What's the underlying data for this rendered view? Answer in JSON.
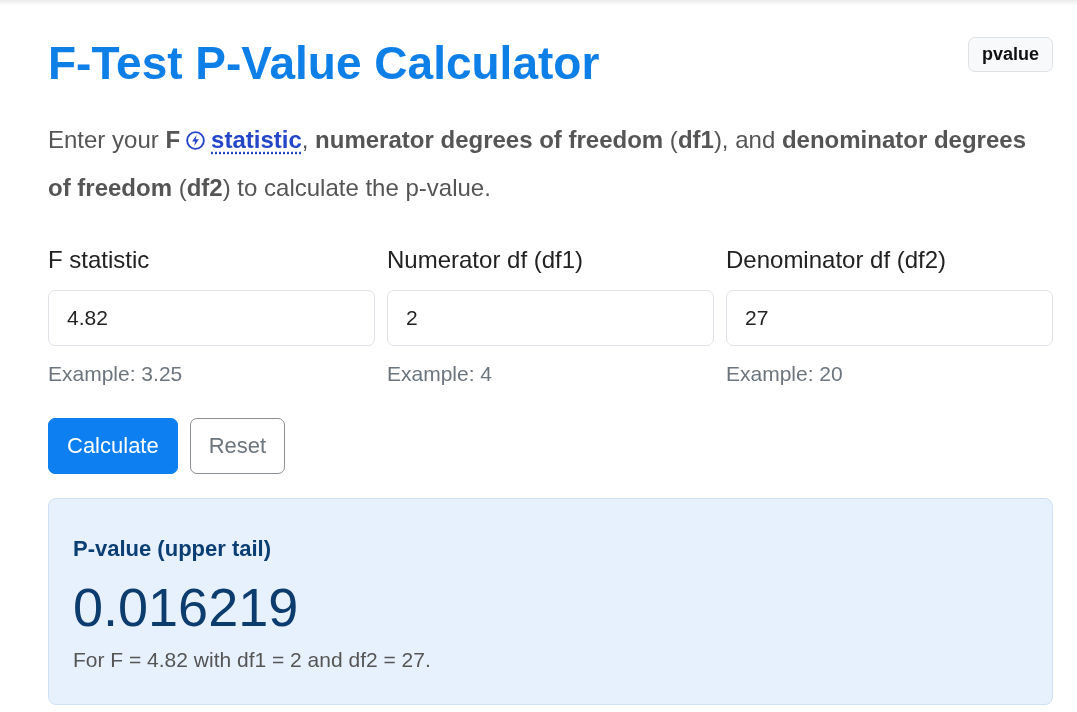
{
  "title": "F-Test P-Value Calculator",
  "badge": "pvalue",
  "intro": {
    "before": "Enter your **F**",
    "link": "statistic",
    "after": ", **numerator degrees of freedom** (**df1**), and **denominator degrees of freedom** (**df2**) to calculate the p-value."
  },
  "fields": [
    {
      "label": "F statistic",
      "value": "4.82",
      "help": "Example: 3.25"
    },
    {
      "label": "Numerator df (df1)",
      "value": "2",
      "help": "Example: 4"
    },
    {
      "label": "Denominator df (df2)",
      "value": "27",
      "help": "Example: 20"
    }
  ],
  "buttons": [
    {
      "label": "Calculate",
      "kind": "primary"
    },
    {
      "label": "Reset",
      "kind": "secondary"
    }
  ],
  "result": {
    "heading": "P-value (upper tail)",
    "value": "0.016219",
    "note": "For F = 4.82 with df1 = 2 and df2 = 27."
  }
}
